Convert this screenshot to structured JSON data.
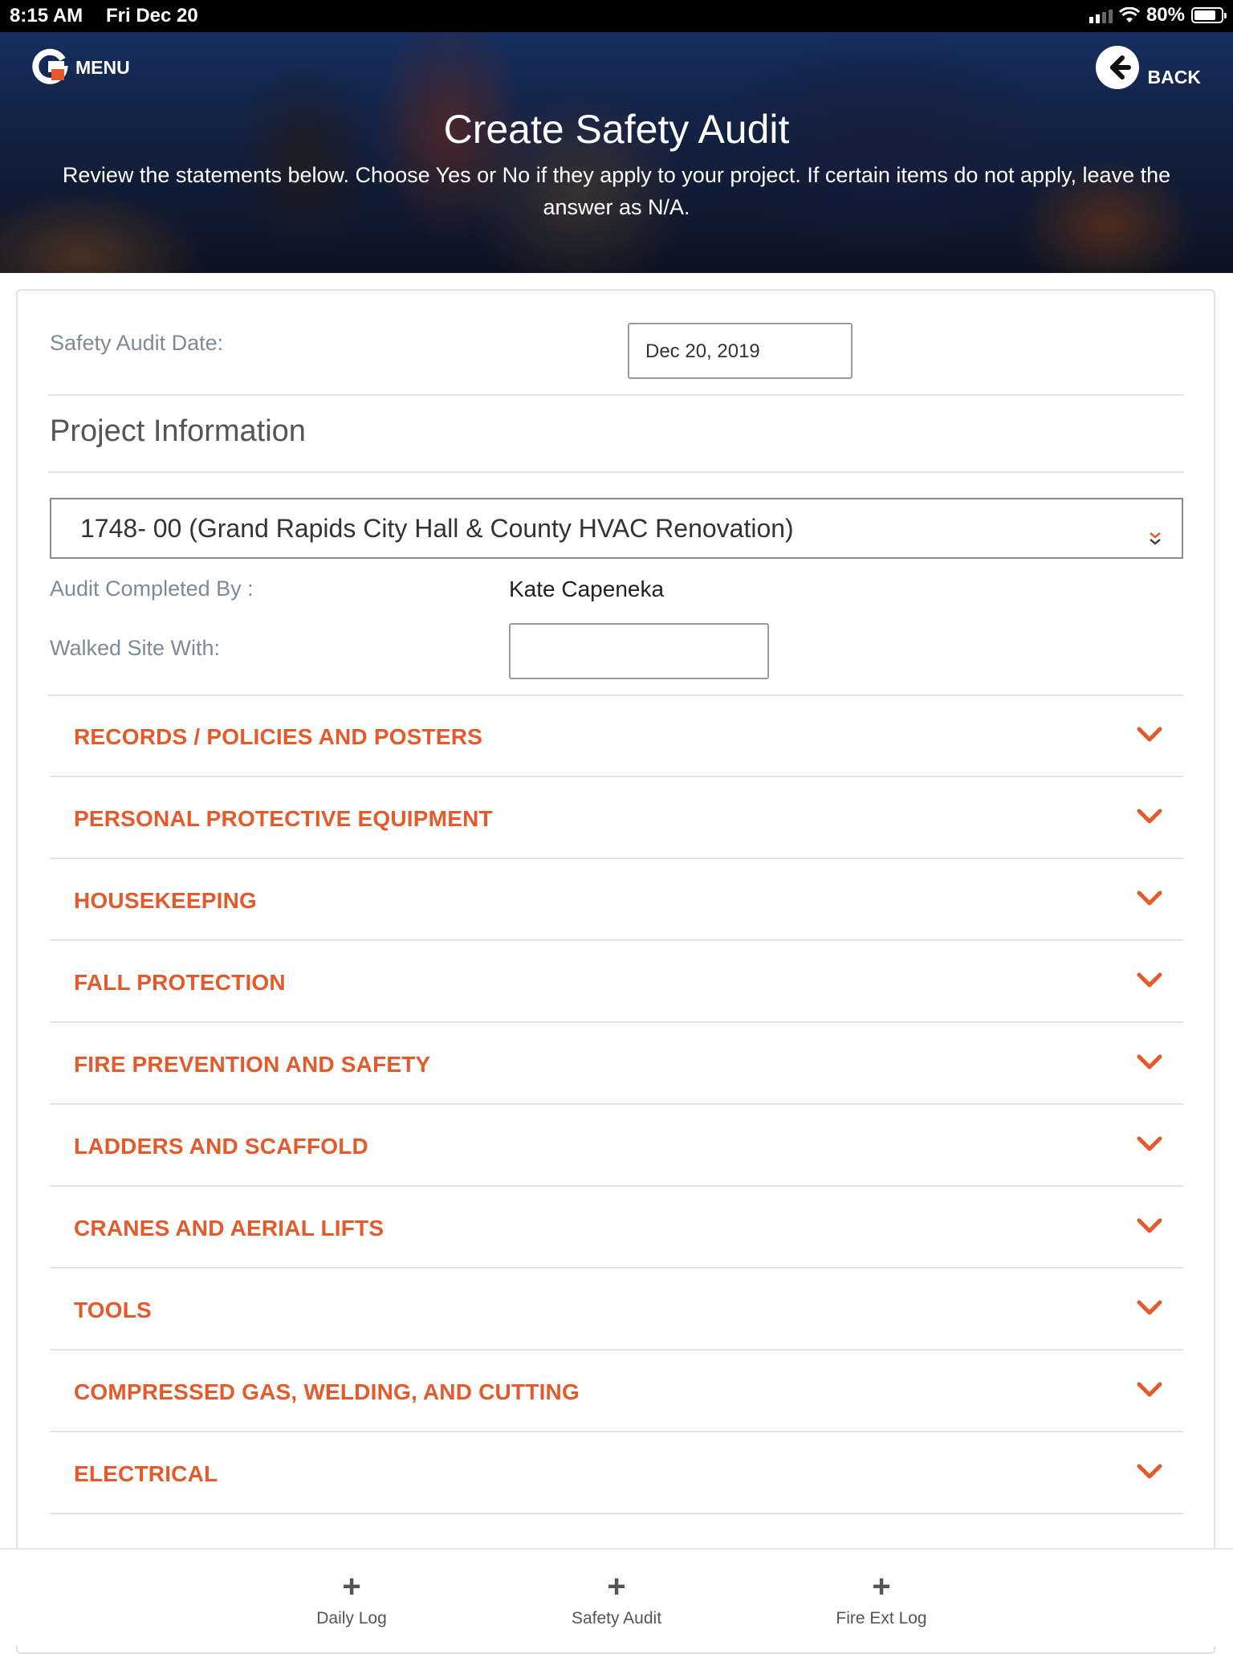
{
  "status_bar": {
    "time": "8:15 AM",
    "date": "Fri Dec 20",
    "battery": "80%",
    "battery_level": 0.8
  },
  "header": {
    "menu_label": "MENU",
    "back_label": "BACK",
    "title": "Create Safety Audit",
    "subtitle": "Review the statements below. Choose Yes or No if they apply to your project. If certain items do not apply, leave the answer as N/A."
  },
  "form": {
    "audit_date_label": "Safety Audit Date:",
    "audit_date_value": "Dec 20, 2019",
    "project_section_title": "Project Information",
    "project_selected": "1748- 00 (Grand Rapids City Hall & County HVAC Renovation)",
    "completed_by_label": "Audit Completed By :",
    "completed_by_value": "Kate Capeneka",
    "walked_with_label": "Walked Site With:",
    "walked_with_value": ""
  },
  "sections": [
    {
      "title": "RECORDS / POLICIES AND POSTERS"
    },
    {
      "title": "PERSONAL PROTECTIVE EQUIPMENT"
    },
    {
      "title": "HOUSEKEEPING"
    },
    {
      "title": "FALL PROTECTION"
    },
    {
      "title": "FIRE PREVENTION AND SAFETY"
    },
    {
      "title": "LADDERS AND SCAFFOLD"
    },
    {
      "title": "CRANES AND AERIAL LIFTS"
    },
    {
      "title": "TOOLS"
    },
    {
      "title": "COMPRESSED GAS, WELDING, AND CUTTING"
    },
    {
      "title": "ELECTRICAL"
    }
  ],
  "tabbar": {
    "tabs": [
      {
        "label": "Daily Log",
        "icon": "plus-icon"
      },
      {
        "label": "Safety Audit",
        "icon": "plus-icon"
      },
      {
        "label": "Fire Ext Log",
        "icon": "plus-icon"
      }
    ]
  },
  "colors": {
    "accent": "#e55a2b",
    "label_gray": "#7c8b99"
  }
}
